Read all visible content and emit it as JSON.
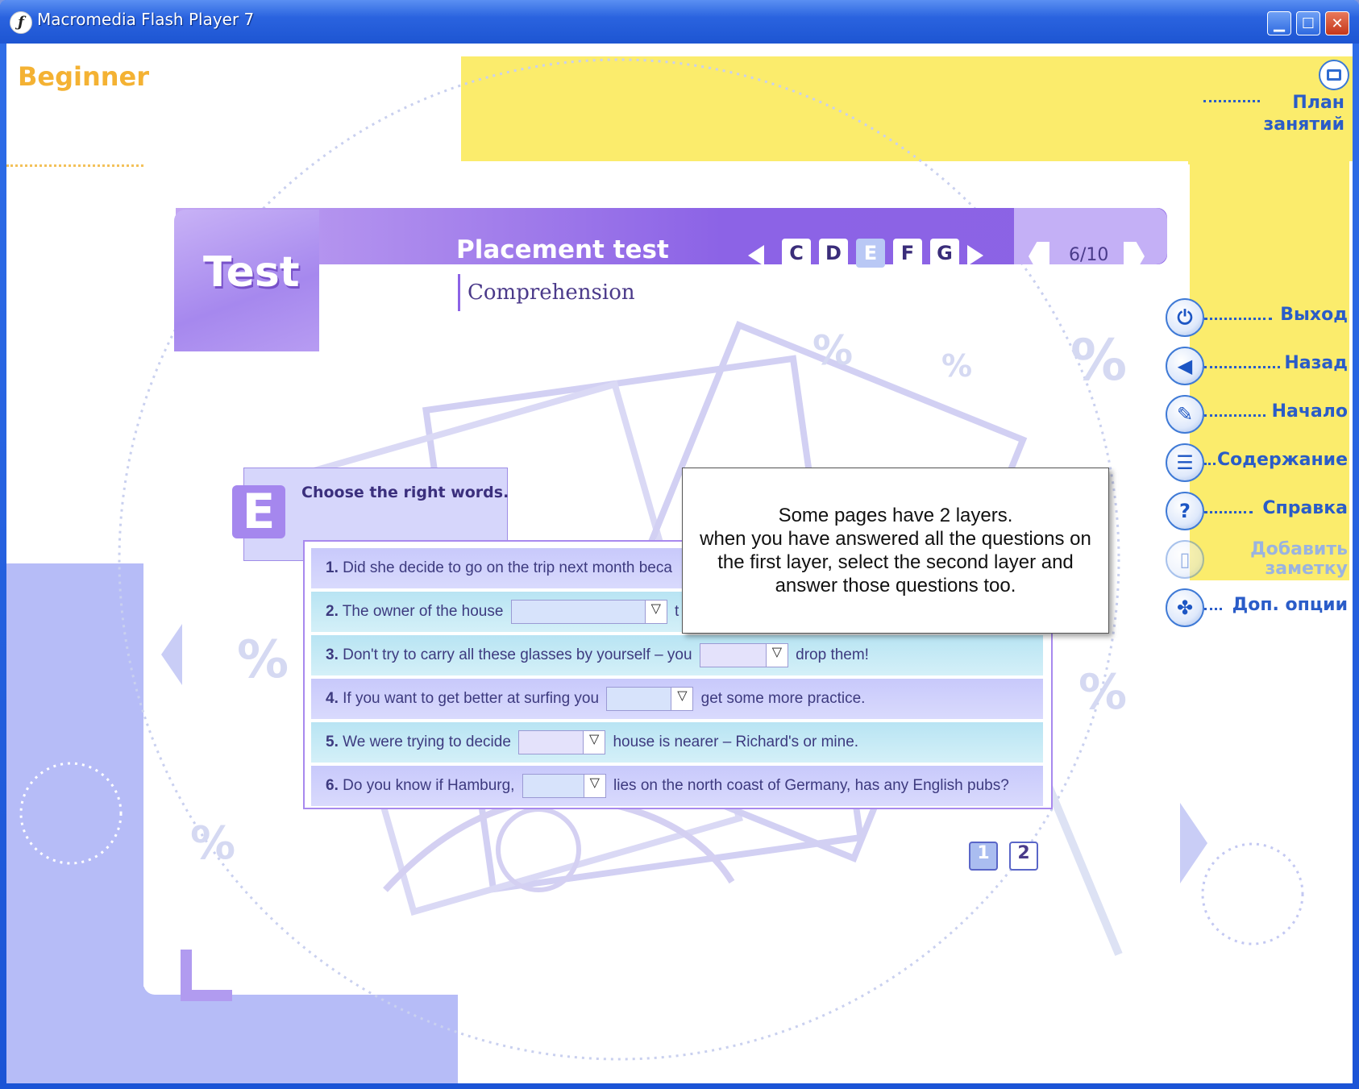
{
  "window": {
    "title": "Macromedia Flash Player 7",
    "icon": "flash-icon",
    "minimize": "▁",
    "maximize": "☐",
    "close": "✕"
  },
  "colors": {
    "titlebar": "#1d55d2",
    "accent_purple": "#8c63e6",
    "yellow_panel": "#fbec6c",
    "lavender": "#b6bcf7",
    "menu_blue": "#2a5cc8",
    "level_orange": "#f4b233"
  },
  "level": "Beginner",
  "plan": {
    "line1": "План",
    "line2": "занятий"
  },
  "side_menu": [
    {
      "label": "Выход",
      "icon": "power-icon",
      "glyph": "⏻"
    },
    {
      "label": "Назад",
      "icon": "back-arrow-icon",
      "glyph": "◀"
    },
    {
      "label": "Начало",
      "icon": "home-icon",
      "glyph": "✎"
    },
    {
      "label": "Содержание",
      "icon": "contents-list-icon",
      "glyph": "☰"
    },
    {
      "label": "Справка",
      "icon": "help-icon",
      "glyph": "?"
    },
    {
      "label_line1": "Добавить",
      "label_line2": "заметку",
      "icon": "note-icon",
      "glyph": "▯",
      "disabled": true
    },
    {
      "label": "Доп. опции",
      "icon": "options-icon",
      "glyph": "✤"
    }
  ],
  "header": {
    "section_title": "Test",
    "title": "Placement test",
    "subtitle": "Comprehension",
    "letters": [
      "C",
      "D",
      "E",
      "F",
      "G"
    ],
    "active_letter": "E",
    "page": "6/10"
  },
  "exercise": {
    "letter": "E",
    "instruction": "Choose the right words.",
    "questions": [
      {
        "num": "1.",
        "before": "Did she decide to go on the trip next month beca",
        "after": ""
      },
      {
        "num": "2.",
        "before": "The owner of the house",
        "after": "t"
      },
      {
        "num": "3.",
        "before": "Don't try to carry all these glasses by yourself – you",
        "after": "drop them!"
      },
      {
        "num": "4.",
        "before": "If you want to get better at surfing you",
        "after": "get some more practice."
      },
      {
        "num": "5.",
        "before": "We were trying to decide",
        "after": "house is nearer – Richard's or mine."
      },
      {
        "num": "6.",
        "before": "Do you know if Hamburg,",
        "after": "lies on the north coast of Germany, has any English pubs?"
      }
    ],
    "layers": [
      "1",
      "2"
    ],
    "active_layer": "1"
  },
  "tooltip": {
    "line1": "Some pages have 2 layers.",
    "line2": "when you have answered all the questions on",
    "line3": "the first layer, select the second layer and",
    "line4": "answer those questions too."
  }
}
